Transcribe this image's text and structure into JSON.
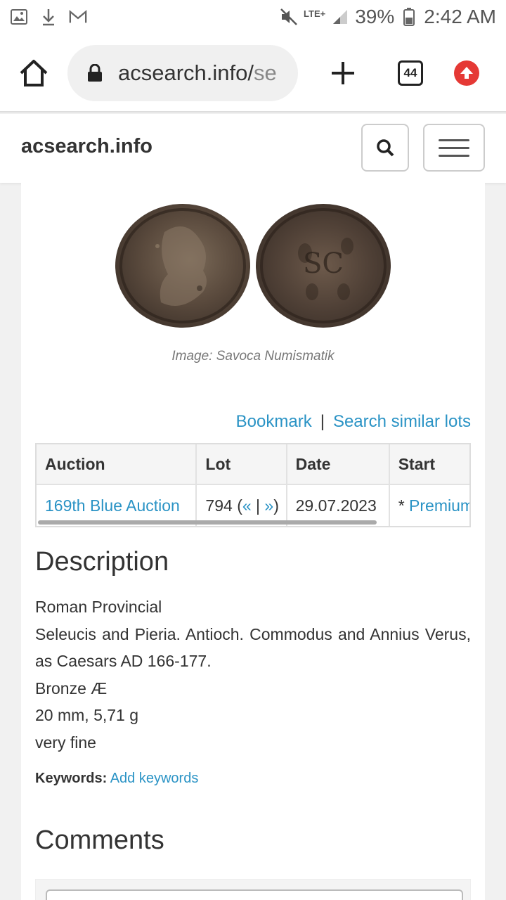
{
  "status": {
    "network": "LTE+",
    "battery": "39%",
    "time": "2:42 AM"
  },
  "browser": {
    "url_main": "acsearch.info/",
    "url_rest": "se",
    "tab_count": "44"
  },
  "site": {
    "brand": "acsearch.info"
  },
  "image_caption": "Image: Savoca Numismatik",
  "actions": {
    "bookmark": "Bookmark",
    "separator": "|",
    "search_similar": "Search similar lots"
  },
  "table": {
    "headers": [
      "Auction",
      "Lot",
      "Date",
      "Start"
    ],
    "row": {
      "auction": "169th Blue Auction",
      "lot": "794",
      "lot_open": "(",
      "lot_prev": "«",
      "lot_sep": " | ",
      "lot_next": "»",
      "lot_close": ")",
      "date": "29.07.2023",
      "start_prefix": "* ",
      "start_link": "Premium"
    }
  },
  "description": {
    "heading": "Description",
    "lines": [
      "Roman Provincial",
      "Seleucis and Pieria. Antioch. Commodus and Annius Verus, as Caesars AD 166-177.",
      "Bronze Æ",
      "20 mm, 5,71 g",
      "very fine"
    ]
  },
  "keywords": {
    "label": "Keywords:",
    "link": "Add keywords"
  },
  "comments": {
    "heading": "Comments"
  },
  "colors": {
    "link": "#2a93c5",
    "update_badge": "#e53935"
  }
}
